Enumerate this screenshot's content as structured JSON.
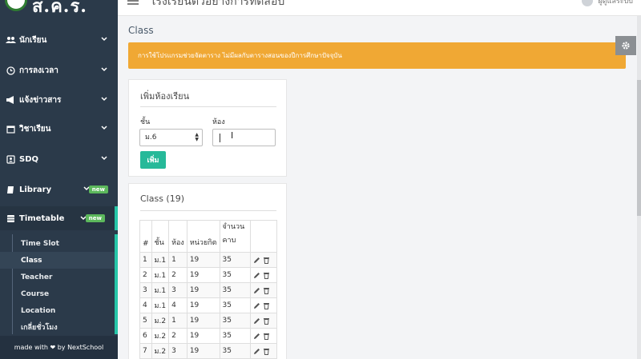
{
  "brand": {
    "name": "ส.ค.ร."
  },
  "topbar": {
    "school_name": "โรงเรียนตัวอย่างการทดสอบ",
    "user_name": "ผู้ดูแลระบบ"
  },
  "sidebar": {
    "items": [
      {
        "label": "นักเรียน",
        "icon": "users-icon"
      },
      {
        "label": "การลงเวลา",
        "icon": "clock-icon"
      },
      {
        "label": "แจ้งข่าวสาร",
        "icon": "megaphone-icon"
      },
      {
        "label": "วิชาเรียน",
        "icon": "calendar-icon"
      },
      {
        "label": "SDQ",
        "icon": "id-card-icon"
      },
      {
        "label": "Library",
        "icon": "book-icon",
        "badge": "new"
      },
      {
        "label": "Timetable",
        "icon": "table-icon",
        "badge": "new"
      }
    ],
    "submenu": [
      "Time Slot",
      "Class",
      "Teacher",
      "Course",
      "Location",
      "เกลี่ยชั่วโมง"
    ],
    "active_sub": "Class",
    "footer": "made with ❤ by NextSchool"
  },
  "page": {
    "title": "Class",
    "alert": "การใช้โปรแกรมช่วยจัดตาราง ไม่มีผลกับตารางสอนของปีการศึกษาปัจจุบัน"
  },
  "add_form": {
    "title": "เพิ่มห้องเรียน",
    "grade_label": "ชั้น",
    "grade_value": "ม.6",
    "room_label": "ห้อง",
    "room_value": "",
    "submit": "เพิ่ม"
  },
  "class_list": {
    "title": "Class (19)",
    "columns": [
      "#",
      "ชั้น",
      "ห้อง",
      "หน่วยกิต",
      "จำนวนคาบ",
      ""
    ],
    "rows": [
      [
        "1",
        "ม.1",
        "1",
        "19",
        "35"
      ],
      [
        "2",
        "ม.1",
        "2",
        "19",
        "35"
      ],
      [
        "3",
        "ม.1",
        "3",
        "19",
        "35"
      ],
      [
        "4",
        "ม.1",
        "4",
        "19",
        "35"
      ],
      [
        "5",
        "ม.2",
        "1",
        "19",
        "35"
      ],
      [
        "6",
        "ม.2",
        "2",
        "19",
        "35"
      ],
      [
        "7",
        "ม.2",
        "3",
        "19",
        "35"
      ]
    ]
  },
  "colors": {
    "sidebar": "#2b3a4a",
    "accent": "#26c6a8",
    "alert": "#f0a834",
    "button": "#26b999",
    "badge": "#5cb85c"
  }
}
